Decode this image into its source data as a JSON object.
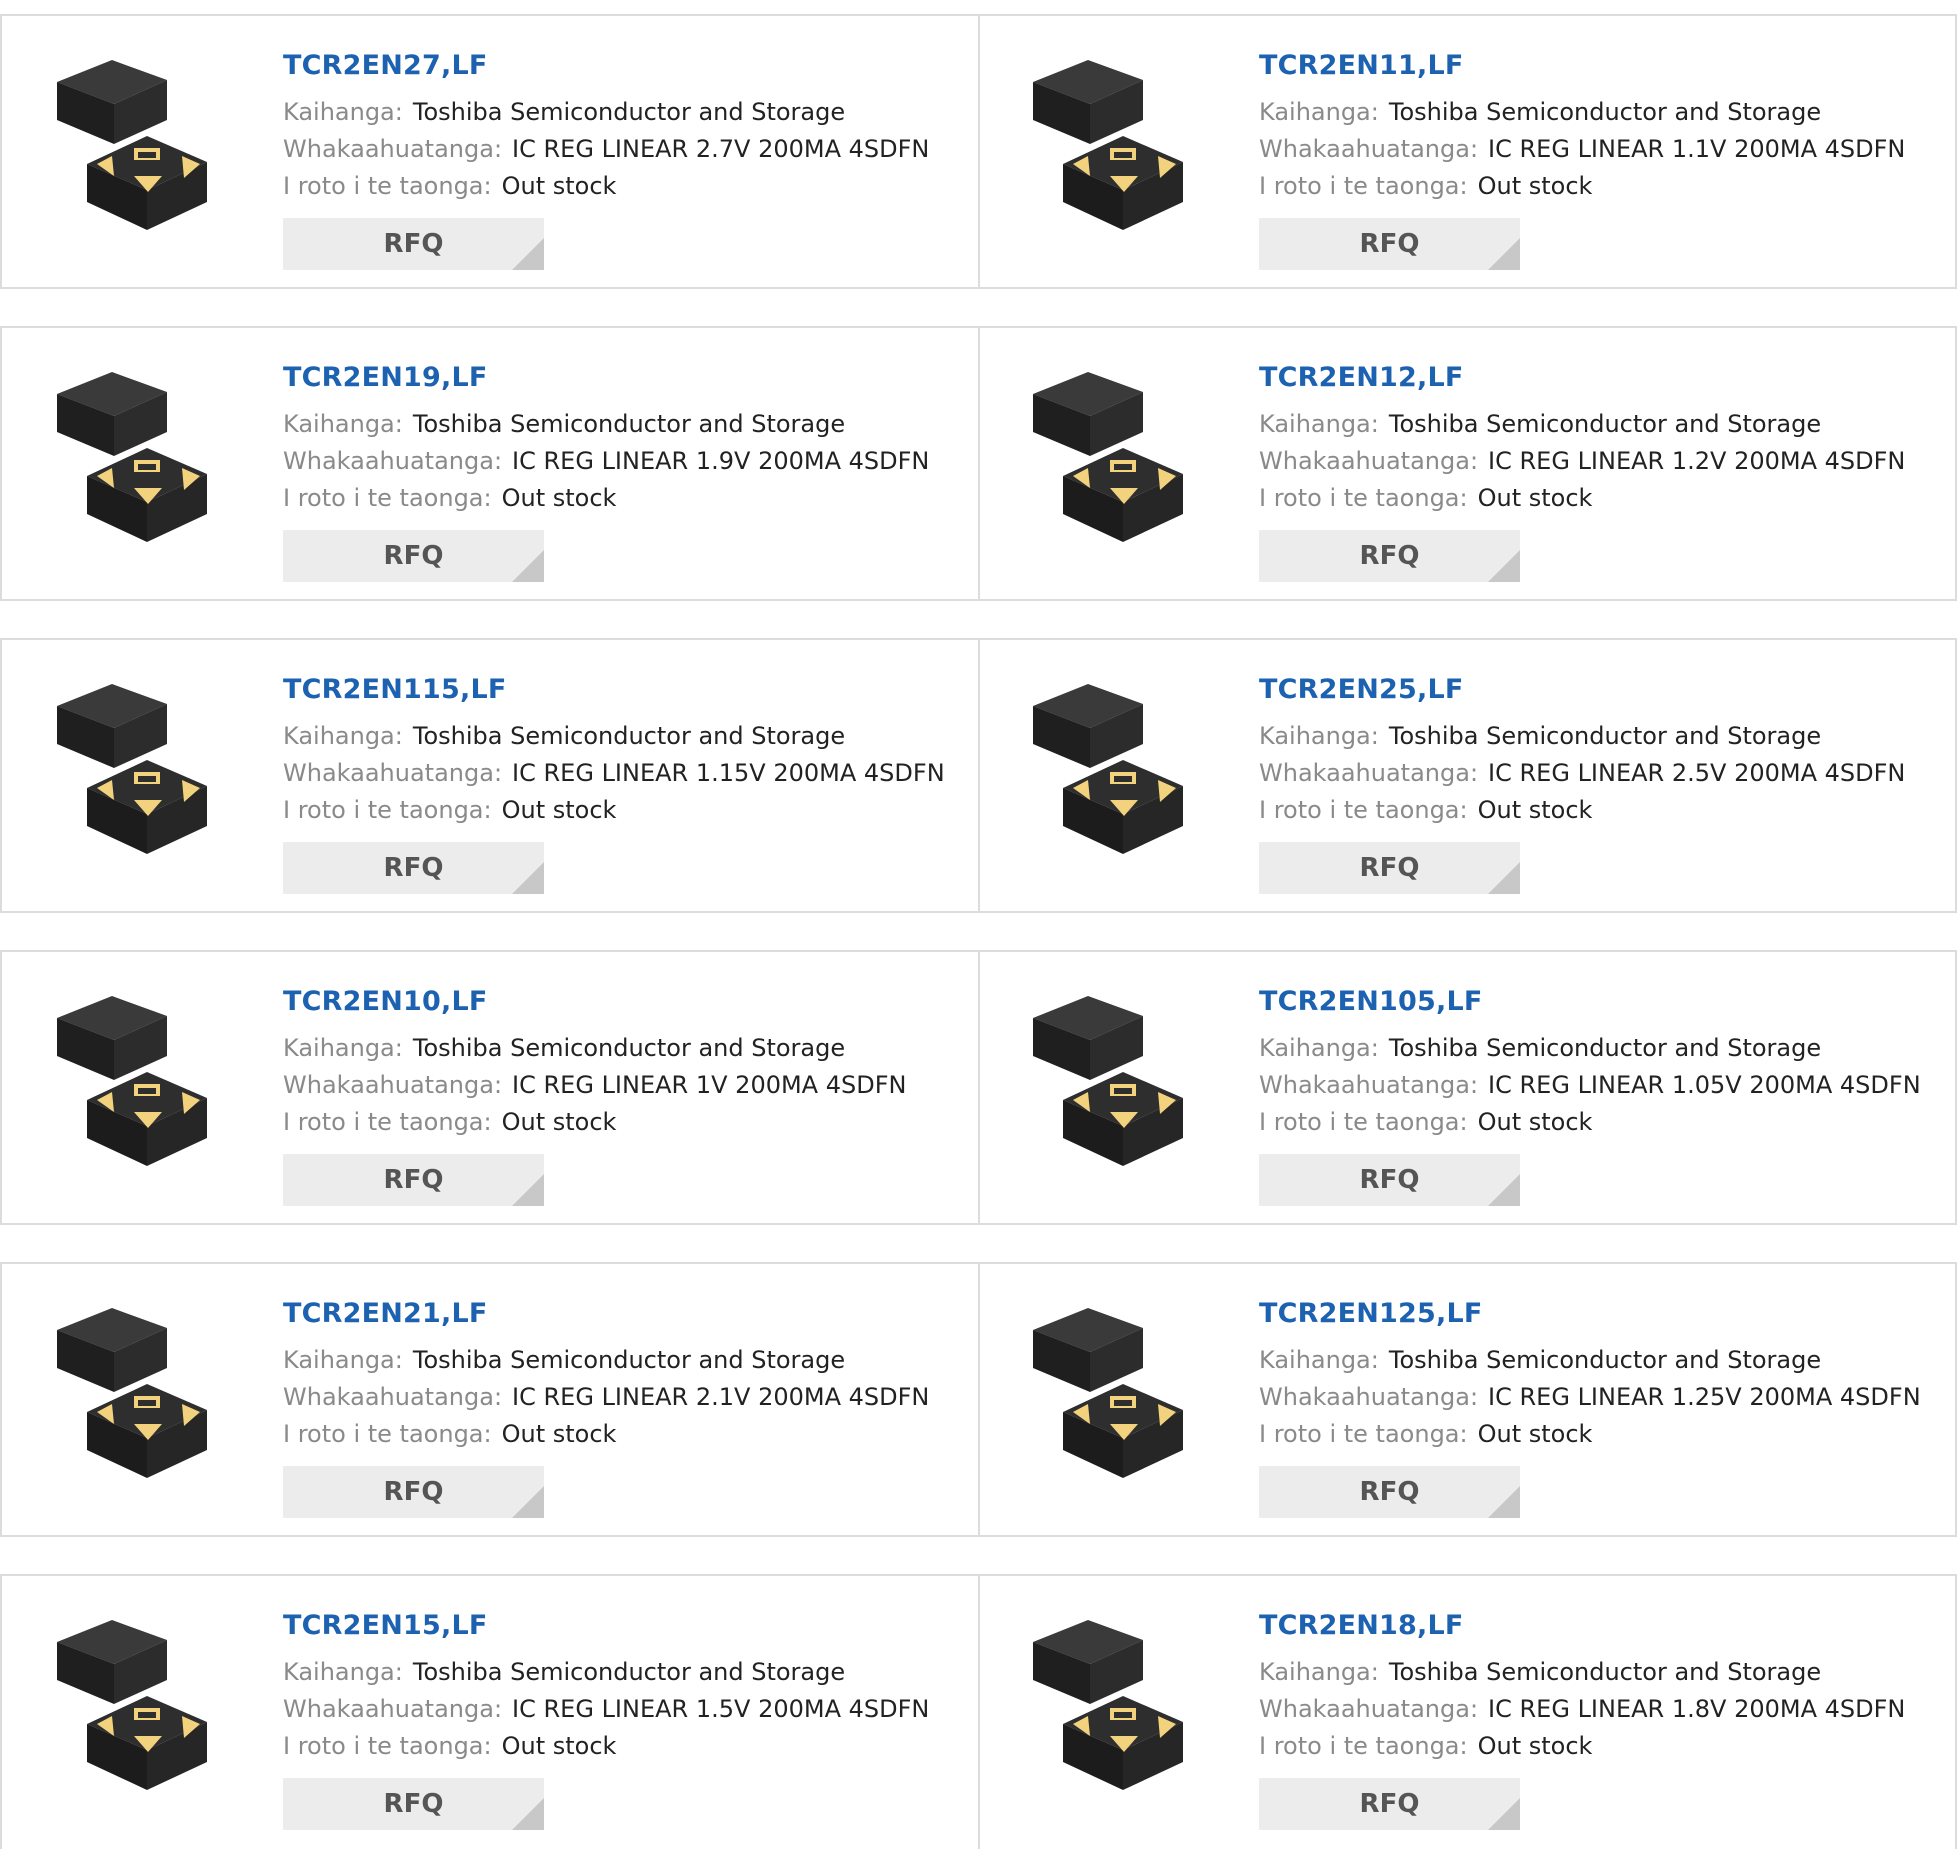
{
  "labels": {
    "manufacturer": "Kaihanga:",
    "description": "Whakaahuatanga:",
    "stock": "I roto i te taonga:",
    "rfq": "RFQ"
  },
  "products": [
    {
      "part": "TCR2EN27,LF",
      "manufacturer": "Toshiba Semiconductor and Storage",
      "description": "IC REG LINEAR 2.7V 200MA 4SDFN",
      "stock": "Out stock"
    },
    {
      "part": "TCR2EN11,LF",
      "manufacturer": "Toshiba Semiconductor and Storage",
      "description": "IC REG LINEAR 1.1V 200MA 4SDFN",
      "stock": "Out stock"
    },
    {
      "part": "TCR2EN19,LF",
      "manufacturer": "Toshiba Semiconductor and Storage",
      "description": "IC REG LINEAR 1.9V 200MA 4SDFN",
      "stock": "Out stock"
    },
    {
      "part": "TCR2EN12,LF",
      "manufacturer": "Toshiba Semiconductor and Storage",
      "description": "IC REG LINEAR 1.2V 200MA 4SDFN",
      "stock": "Out stock"
    },
    {
      "part": "TCR2EN115,LF",
      "manufacturer": "Toshiba Semiconductor and Storage",
      "description": "IC REG LINEAR 1.15V 200MA 4SDFN",
      "stock": "Out stock"
    },
    {
      "part": "TCR2EN25,LF",
      "manufacturer": "Toshiba Semiconductor and Storage",
      "description": "IC REG LINEAR 2.5V 200MA 4SDFN",
      "stock": "Out stock"
    },
    {
      "part": "TCR2EN10,LF",
      "manufacturer": "Toshiba Semiconductor and Storage",
      "description": "IC REG LINEAR 1V 200MA 4SDFN",
      "stock": "Out stock"
    },
    {
      "part": "TCR2EN105,LF",
      "manufacturer": "Toshiba Semiconductor and Storage",
      "description": "IC REG LINEAR 1.05V 200MA 4SDFN",
      "stock": "Out stock"
    },
    {
      "part": "TCR2EN21,LF",
      "manufacturer": "Toshiba Semiconductor and Storage",
      "description": "IC REG LINEAR 2.1V 200MA 4SDFN",
      "stock": "Out stock"
    },
    {
      "part": "TCR2EN125,LF",
      "manufacturer": "Toshiba Semiconductor and Storage",
      "description": "IC REG LINEAR 1.25V 200MA 4SDFN",
      "stock": "Out stock"
    },
    {
      "part": "TCR2EN15,LF",
      "manufacturer": "Toshiba Semiconductor and Storage",
      "description": "IC REG LINEAR 1.5V 200MA 4SDFN",
      "stock": "Out stock"
    },
    {
      "part": "TCR2EN18,LF",
      "manufacturer": "Toshiba Semiconductor and Storage",
      "description": "IC REG LINEAR 1.8V 200MA 4SDFN",
      "stock": "Out stock"
    }
  ],
  "colors": {
    "part_link": "#1d62b0",
    "label": "#8a8a8a",
    "value": "#222222",
    "button_bg": "#ececec",
    "chip_body": "#2b2b2b",
    "chip_pad": "#f3d27e"
  },
  "icons": {
    "product_image": "4sdfn-package-icon"
  }
}
